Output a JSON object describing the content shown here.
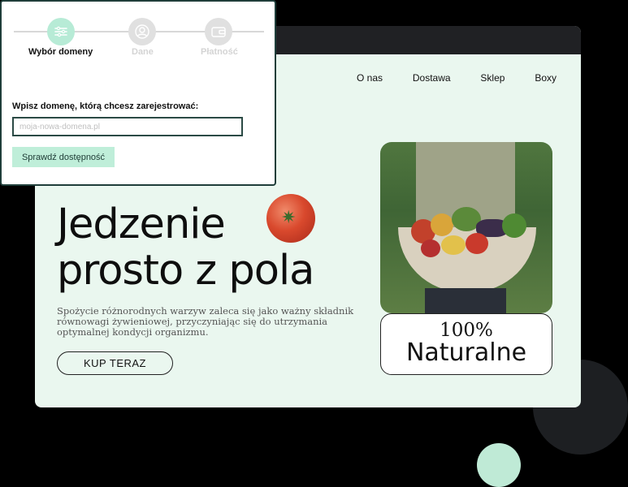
{
  "wizard": {
    "steps": [
      {
        "label": "Wybór domeny",
        "icon": "sliders-icon"
      },
      {
        "label": "Dane",
        "icon": "user-icon"
      },
      {
        "label": "Płatność",
        "icon": "wallet-icon"
      }
    ],
    "field_label": "Wpisz domenę, którą chcesz zarejestrować:",
    "input_placeholder": "moja-nowa-domena.pl",
    "check_button": "Sprawdź dostępność"
  },
  "site": {
    "nav": [
      "O nas",
      "Dostawa",
      "Sklep",
      "Boxy"
    ],
    "headline_line1": "Jedzenie",
    "headline_line2": "prosto z pola",
    "description": "Spożycie różnorodnych warzyw zaleca się jako ważny składnik równowagi żywieniowej, przyczyniając się do utrzymania optymalnej kondycji organizmu.",
    "buy_button": "KUP TERAZ",
    "badge_percent": "100%",
    "badge_word": "Naturalne"
  },
  "colors": {
    "accent_mint": "#b7ebd6",
    "site_background": "#eaf7ef",
    "card_border": "#1f3e3a"
  }
}
